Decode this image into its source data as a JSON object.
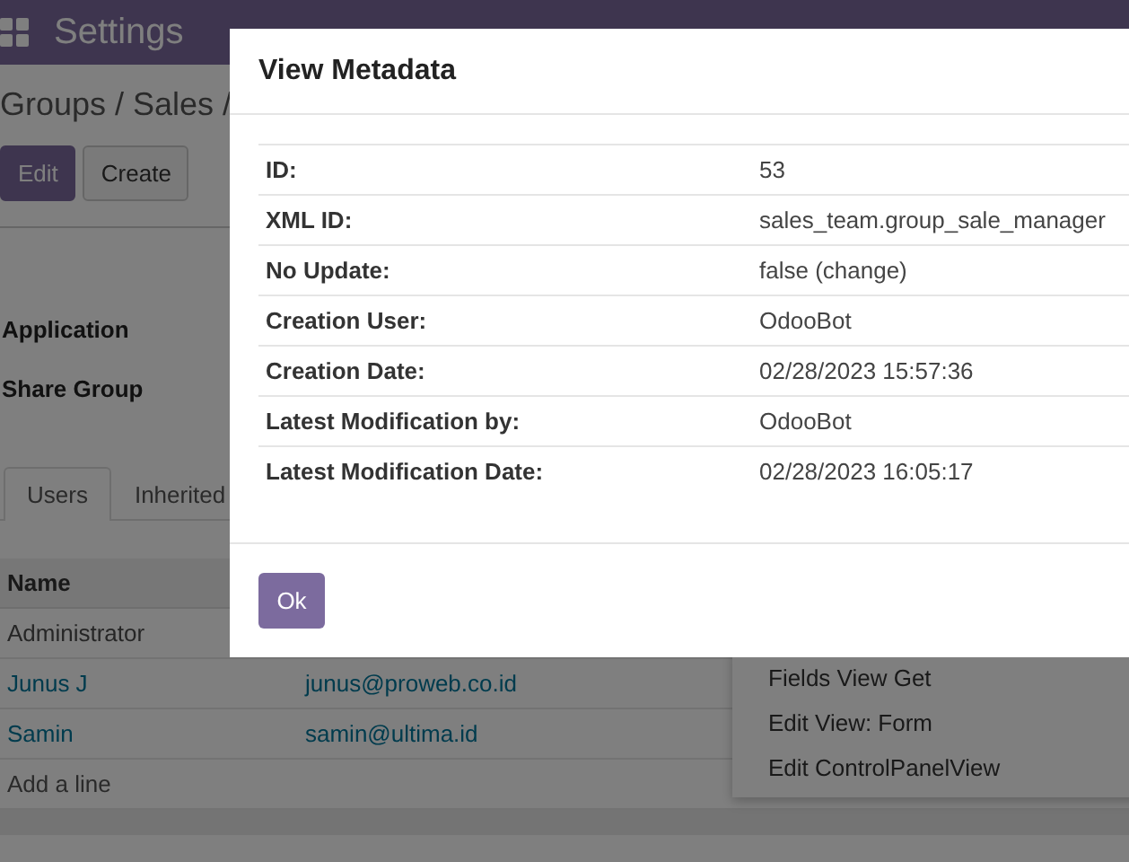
{
  "navbar": {
    "app_title": "Settings"
  },
  "breadcrumb": "Groups / Sales /",
  "buttons": [
    {
      "label": "Edit",
      "kind": "primary"
    },
    {
      "label": "Create",
      "kind": "secondary"
    }
  ],
  "fields": [
    "Application",
    "Share Group"
  ],
  "tabs": [
    {
      "label": "Users",
      "selected": true
    },
    {
      "label": "Inherited",
      "selected": false
    }
  ],
  "table": {
    "columns": [
      "Name"
    ],
    "rows": [
      {
        "name": "Administrator",
        "link": false
      },
      {
        "name": "Junus J",
        "email": "junus@proweb.co.id",
        "link": true
      },
      {
        "name": "Samin",
        "email": "samin@ultima.id",
        "link": true
      }
    ],
    "add_line": "Add a line"
  },
  "dropdown": {
    "items": [
      "Fields View Get",
      "Edit View: Form",
      "Edit ControlPanelView"
    ]
  },
  "dialog": {
    "title": "View Metadata",
    "rows": [
      {
        "label": "ID:",
        "value": "53"
      },
      {
        "label": "XML ID:",
        "value": "sales_team.group_sale_manager"
      },
      {
        "label": "No Update:",
        "value": "false (change)"
      },
      {
        "label": "Creation User:",
        "value": "OdooBot"
      },
      {
        "label": "Creation Date:",
        "value": "02/28/2023 15:57:36"
      },
      {
        "label": "Latest Modification by:",
        "value": "OdooBot"
      },
      {
        "label": "Latest Modification Date:",
        "value": "02/28/2023 16:05:17"
      }
    ],
    "button": "Ok"
  }
}
